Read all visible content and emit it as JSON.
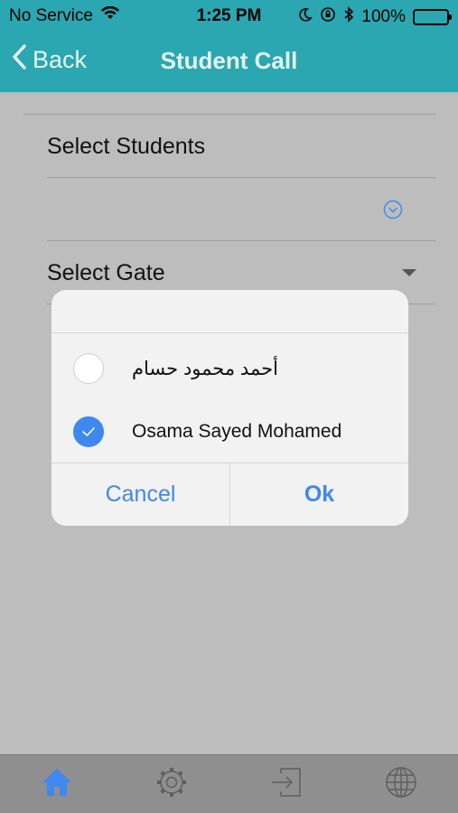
{
  "status_bar": {
    "carrier": "No Service",
    "time": "1:25 PM",
    "battery": "100%"
  },
  "nav": {
    "back_label": "Back",
    "title": "Student Call"
  },
  "form": {
    "students_label": "Select Students",
    "gate_label": "Select Gate"
  },
  "dialog": {
    "options": [
      {
        "label": "أحمد محمود حسام",
        "checked": false
      },
      {
        "label": "Osama Sayed Mohamed",
        "checked": true
      }
    ],
    "cancel_label": "Cancel",
    "ok_label": "Ok"
  },
  "tab_bar": {
    "items": [
      {
        "icon": "home-icon",
        "active": true
      },
      {
        "icon": "settings-gear-icon",
        "active": false
      },
      {
        "icon": "logout-icon",
        "active": false
      },
      {
        "icon": "globe-icon",
        "active": false
      }
    ]
  },
  "colors": {
    "header": "#2aa7b1",
    "accent": "#3e88f0",
    "overlay": "#bdbdbd",
    "tab_bar": "#8f8f8f"
  }
}
